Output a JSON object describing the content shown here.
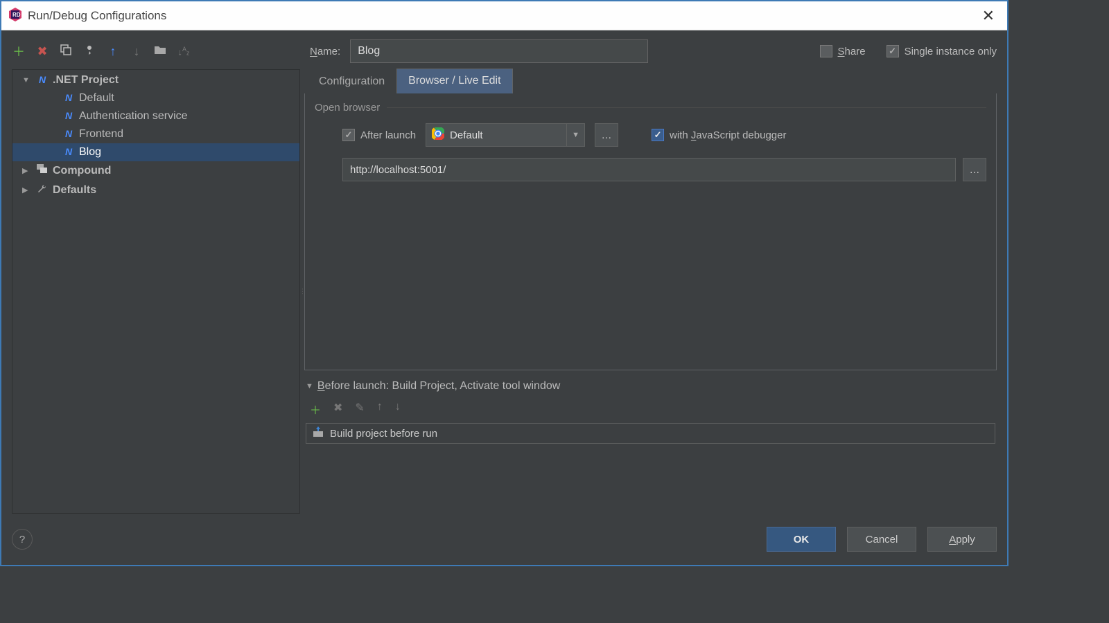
{
  "window": {
    "title": "Run/Debug Configurations"
  },
  "toolbar": {
    "add_tip": "Add",
    "remove_tip": "Remove",
    "copy_tip": "Copy",
    "settings_tip": "Settings",
    "up_tip": "Move Up",
    "down_tip": "Move Down",
    "folder_tip": "Folder",
    "sort_tip": "Sort"
  },
  "nameRow": {
    "label": "Name:",
    "value": "Blog"
  },
  "shareRow": {
    "share_label": "Share",
    "share_checked": false,
    "single_label": "Single instance only",
    "single_checked": true
  },
  "tree": {
    "items": [
      {
        "label": ".NET Project",
        "depth": 0,
        "arrow": "▼",
        "icon": "dotnet",
        "bold": true
      },
      {
        "label": "Default",
        "depth": 1,
        "icon": "dotnet"
      },
      {
        "label": "Authentication service",
        "depth": 1,
        "icon": "dotnet"
      },
      {
        "label": "Frontend",
        "depth": 1,
        "icon": "dotnet"
      },
      {
        "label": "Blog",
        "depth": 1,
        "icon": "dotnet",
        "selected": true
      },
      {
        "label": "Compound",
        "depth": 0,
        "arrow": "▶",
        "icon": "compound",
        "bold": true
      },
      {
        "label": "Defaults",
        "depth": 0,
        "arrow": "▶",
        "icon": "wrench",
        "bold": true
      }
    ]
  },
  "tabs": {
    "items": [
      {
        "label": "Configuration",
        "active": false
      },
      {
        "label": "Browser / Live Edit",
        "active": true
      }
    ]
  },
  "browserPanel": {
    "group_label": "Open browser",
    "after_launch_label": "After launch",
    "after_launch_checked": true,
    "browser_select": "Default",
    "with_debugger_label": "with JavaScript debugger",
    "with_debugger_checked": true,
    "url": "http://localhost:5001/"
  },
  "beforeLaunch": {
    "header": "Before launch: Build Project, Activate tool window",
    "item": "Build project before run"
  },
  "footer": {
    "ok": "OK",
    "cancel": "Cancel",
    "apply": "Apply"
  }
}
